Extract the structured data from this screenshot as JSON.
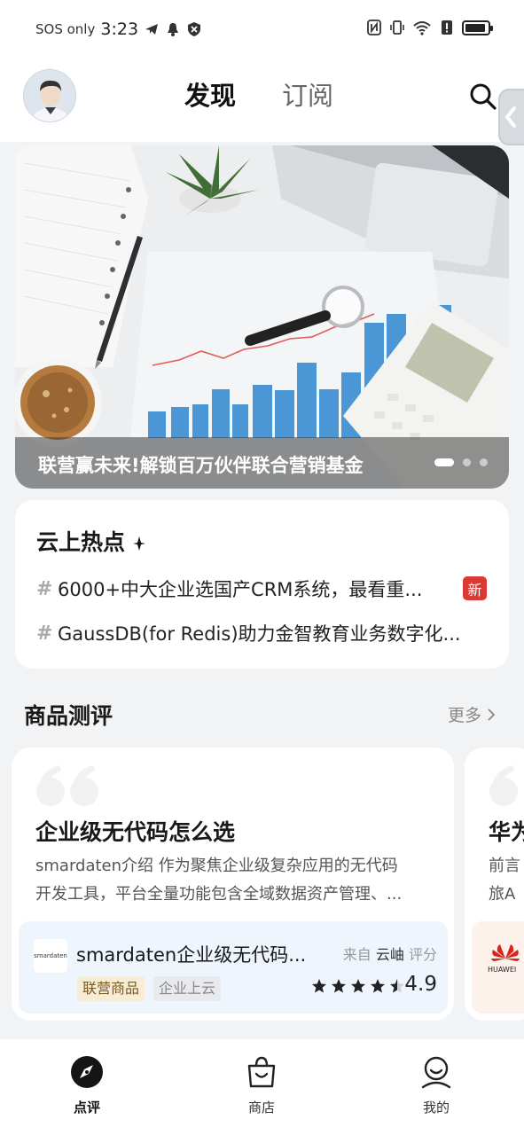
{
  "status_bar": {
    "carrier": "SOS only",
    "time": "3:23"
  },
  "header": {
    "tabs": [
      {
        "label": "发现",
        "active": true
      },
      {
        "label": "订阅",
        "active": false
      }
    ]
  },
  "banner": {
    "title": "联营赢未来!解锁百万伙伴联合营销基金",
    "slide_count": 3,
    "active_slide": 1
  },
  "hot_topics": {
    "title": "云上热点",
    "items": [
      {
        "text": "6000+中大企业选国产CRM系统，最看重...",
        "badge": "新"
      },
      {
        "text": "GaussDB(for Redis)助力金智教育业务数字化...",
        "badge": ""
      }
    ]
  },
  "reviews": {
    "section_title": "商品测评",
    "more_label": "更多",
    "cards": [
      {
        "title": "企业级无代码怎么选",
        "desc_line1": "smardaten介绍 作为聚焦企业级复杂应用的无代码",
        "desc_line2": "开发工具，平台全量功能包含全域数据资产管理、...",
        "product": {
          "logo_text": "smardaten",
          "name": "smardaten企业级无代码...",
          "source_prefix": "来自",
          "source_name": "云岫",
          "source_suffix": "评分",
          "tags": [
            "联营商品",
            "企业上云"
          ],
          "rating": "4.9",
          "stars": 4.5
        }
      },
      {
        "title": "华为",
        "desc_line1": "前言",
        "desc_line2": "旅A",
        "product": {
          "logo_text": "HUAWEI"
        }
      }
    ]
  },
  "bottom_nav": {
    "items": [
      {
        "label": "点评",
        "icon": "compass-icon",
        "active": true
      },
      {
        "label": "商店",
        "icon": "shopping-bag-icon",
        "active": false
      },
      {
        "label": "我的",
        "icon": "profile-icon",
        "active": false
      }
    ]
  },
  "colors": {
    "badge_red": "#d93a35",
    "product_box_bg": "#eef5fd",
    "tag_gold_bg": "#f7ecd6"
  }
}
